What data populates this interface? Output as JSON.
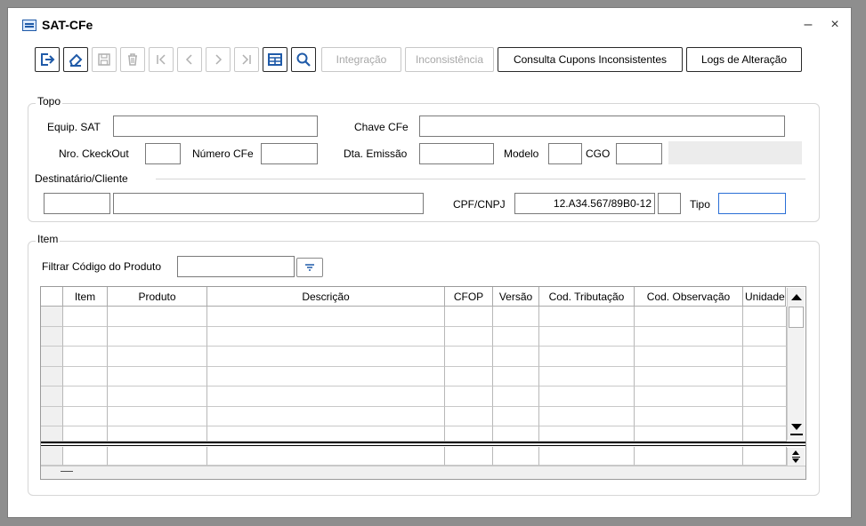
{
  "window": {
    "title": "SAT-CFe",
    "minimize_glyph": "–",
    "close_glyph": "×"
  },
  "toolbar": {
    "integracao_label": "Integração",
    "inconsistencia_label": "Inconsistência",
    "consulta_label": "Consulta Cupons Inconsistentes",
    "logs_label": "Logs de Alteração"
  },
  "topo": {
    "group_label": "Topo",
    "equip_sat_label": "Equip. SAT",
    "equip_sat_value": "",
    "chave_cfe_label": "Chave CFe",
    "chave_cfe_value": "",
    "nro_checkout_label": "Nro. CkeckOut",
    "nro_checkout_value": "",
    "numero_cfe_label": "Número CFe",
    "numero_cfe_value": "",
    "dta_emissao_label": "Dta. Emissão",
    "dta_emissao_value": "",
    "modelo_label": "Modelo",
    "modelo_value": "",
    "cgo_label": "CGO",
    "cgo_value": "",
    "destinatario_label": "Destinatário/Cliente",
    "dest_code_value": "",
    "dest_name_value": "",
    "cpf_cnpj_label": "CPF/CNPJ",
    "cpf_cnpj_value": "12.A34.567/89B0-12",
    "cpf_digit_value": "",
    "tipo_label": "Tipo",
    "tipo_value": ""
  },
  "item": {
    "group_label": "Item",
    "filter_label": "Filtrar Código do Produto",
    "filter_value": "",
    "columns": [
      "Item",
      "Produto",
      "Descrição",
      "CFOP",
      "Versão",
      "Cod. Tributação",
      "Cod. Observação",
      "Unidade"
    ],
    "footer_dash": "—"
  },
  "colors": {
    "accent": "#2a6fd6",
    "border": "#7a7a7a",
    "group_border": "#d6d6d6"
  }
}
